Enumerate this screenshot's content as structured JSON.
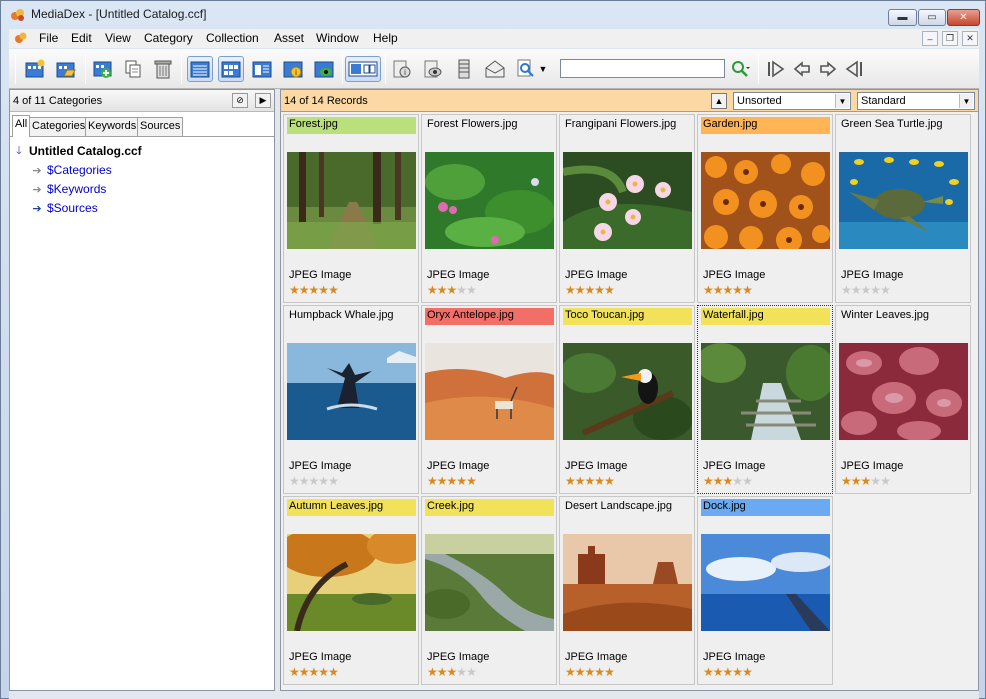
{
  "window": {
    "title": "MediaDex - [Untitled Catalog.ccf]"
  },
  "menu": [
    "File",
    "Edit",
    "View",
    "Category",
    "Collection",
    "Asset",
    "Window",
    "Help"
  ],
  "search": {
    "value": "",
    "placeholder": ""
  },
  "left": {
    "count": "4 of 11 Categories",
    "tabs": [
      "All",
      "Categories",
      "Keywords",
      "Sources"
    ],
    "tree": {
      "root": "Untitled Catalog.ccf",
      "children": [
        "$Categories",
        "$Keywords",
        "$Sources"
      ]
    }
  },
  "right": {
    "count": "14 of 14 Records",
    "sort": "Unsorted",
    "view": "Standard"
  },
  "colors": {
    "accent": "#0000cc",
    "record_header": "#fcd9a4",
    "star": "#d98a1f"
  },
  "records": [
    {
      "name": "Forest.jpg",
      "type": "JPEG Image",
      "rating": 5,
      "label": "#b9e07a"
    },
    {
      "name": "Forest Flowers.jpg",
      "type": "JPEG Image",
      "rating": 3,
      "label": ""
    },
    {
      "name": "Frangipani Flowers.jpg",
      "type": "JPEG Image",
      "rating": 5,
      "label": ""
    },
    {
      "name": "Garden.jpg",
      "type": "JPEG Image",
      "rating": 5,
      "label": "#ffb455"
    },
    {
      "name": "Green Sea Turtle.jpg",
      "type": "JPEG Image",
      "rating": 0,
      "label": ""
    },
    {
      "name": "Humpback Whale.jpg",
      "type": "JPEG Image",
      "rating": 0,
      "label": ""
    },
    {
      "name": "Oryx Antelope.jpg",
      "type": "JPEG Image",
      "rating": 5,
      "label": "#f26f68"
    },
    {
      "name": "Toco Toucan.jpg",
      "type": "JPEG Image",
      "rating": 5,
      "label": "#f1e25a"
    },
    {
      "name": "Waterfall.jpg",
      "type": "JPEG Image",
      "rating": 3,
      "label": "#f1e25a"
    },
    {
      "name": "Winter Leaves.jpg",
      "type": "JPEG Image",
      "rating": 3,
      "label": ""
    },
    {
      "name": "Autumn Leaves.jpg",
      "type": "JPEG Image",
      "rating": 5,
      "label": "#f1e25a"
    },
    {
      "name": "Creek.jpg",
      "type": "JPEG Image",
      "rating": 3,
      "label": "#f1e25a"
    },
    {
      "name": "Desert Landscape.jpg",
      "type": "JPEG Image",
      "rating": 5,
      "label": ""
    },
    {
      "name": "Dock.jpg",
      "type": "JPEG Image",
      "rating": 5,
      "label": "#6aaaf2"
    }
  ]
}
